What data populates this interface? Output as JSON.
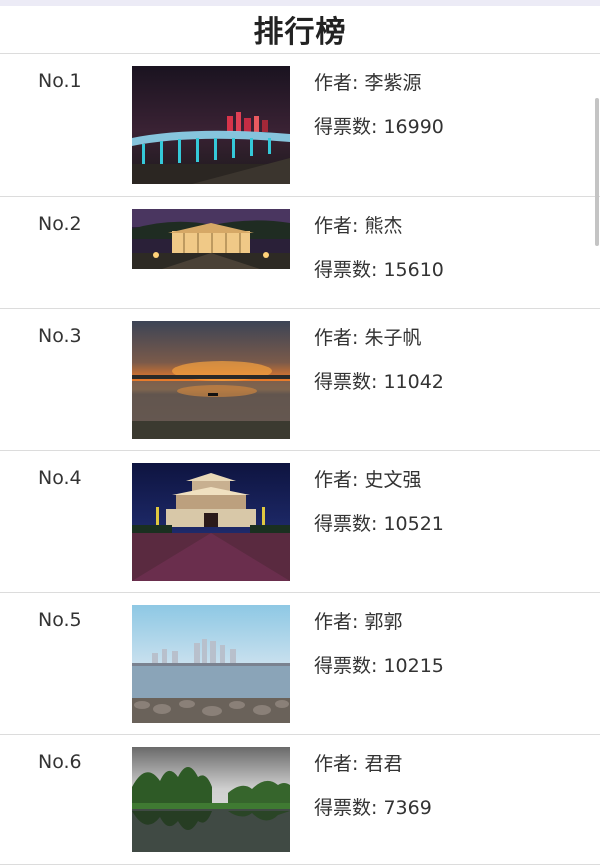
{
  "page": {
    "title": "排行榜"
  },
  "labels": {
    "author_prefix": "作者: ",
    "votes_prefix": "得票数: "
  },
  "entries": [
    {
      "rank": "No.1",
      "author": "李紫源",
      "votes": "16990",
      "photo_icon": "night-bridge-photo"
    },
    {
      "rank": "No.2",
      "author": "熊杰",
      "votes": "15610",
      "photo_icon": "night-pavilion-photo"
    },
    {
      "rank": "No.3",
      "author": "朱子帆",
      "votes": "11042",
      "photo_icon": "sunset-lake-photo"
    },
    {
      "rank": "No.4",
      "author": "史文强",
      "votes": "10521",
      "photo_icon": "night-gate-tower-photo"
    },
    {
      "rank": "No.5",
      "author": "郭郭",
      "votes": "10215",
      "photo_icon": "city-skyline-lake-photo"
    },
    {
      "rank": "No.6",
      "author": "君君",
      "votes": "7369",
      "photo_icon": "karst-mountains-river-photo"
    }
  ]
}
